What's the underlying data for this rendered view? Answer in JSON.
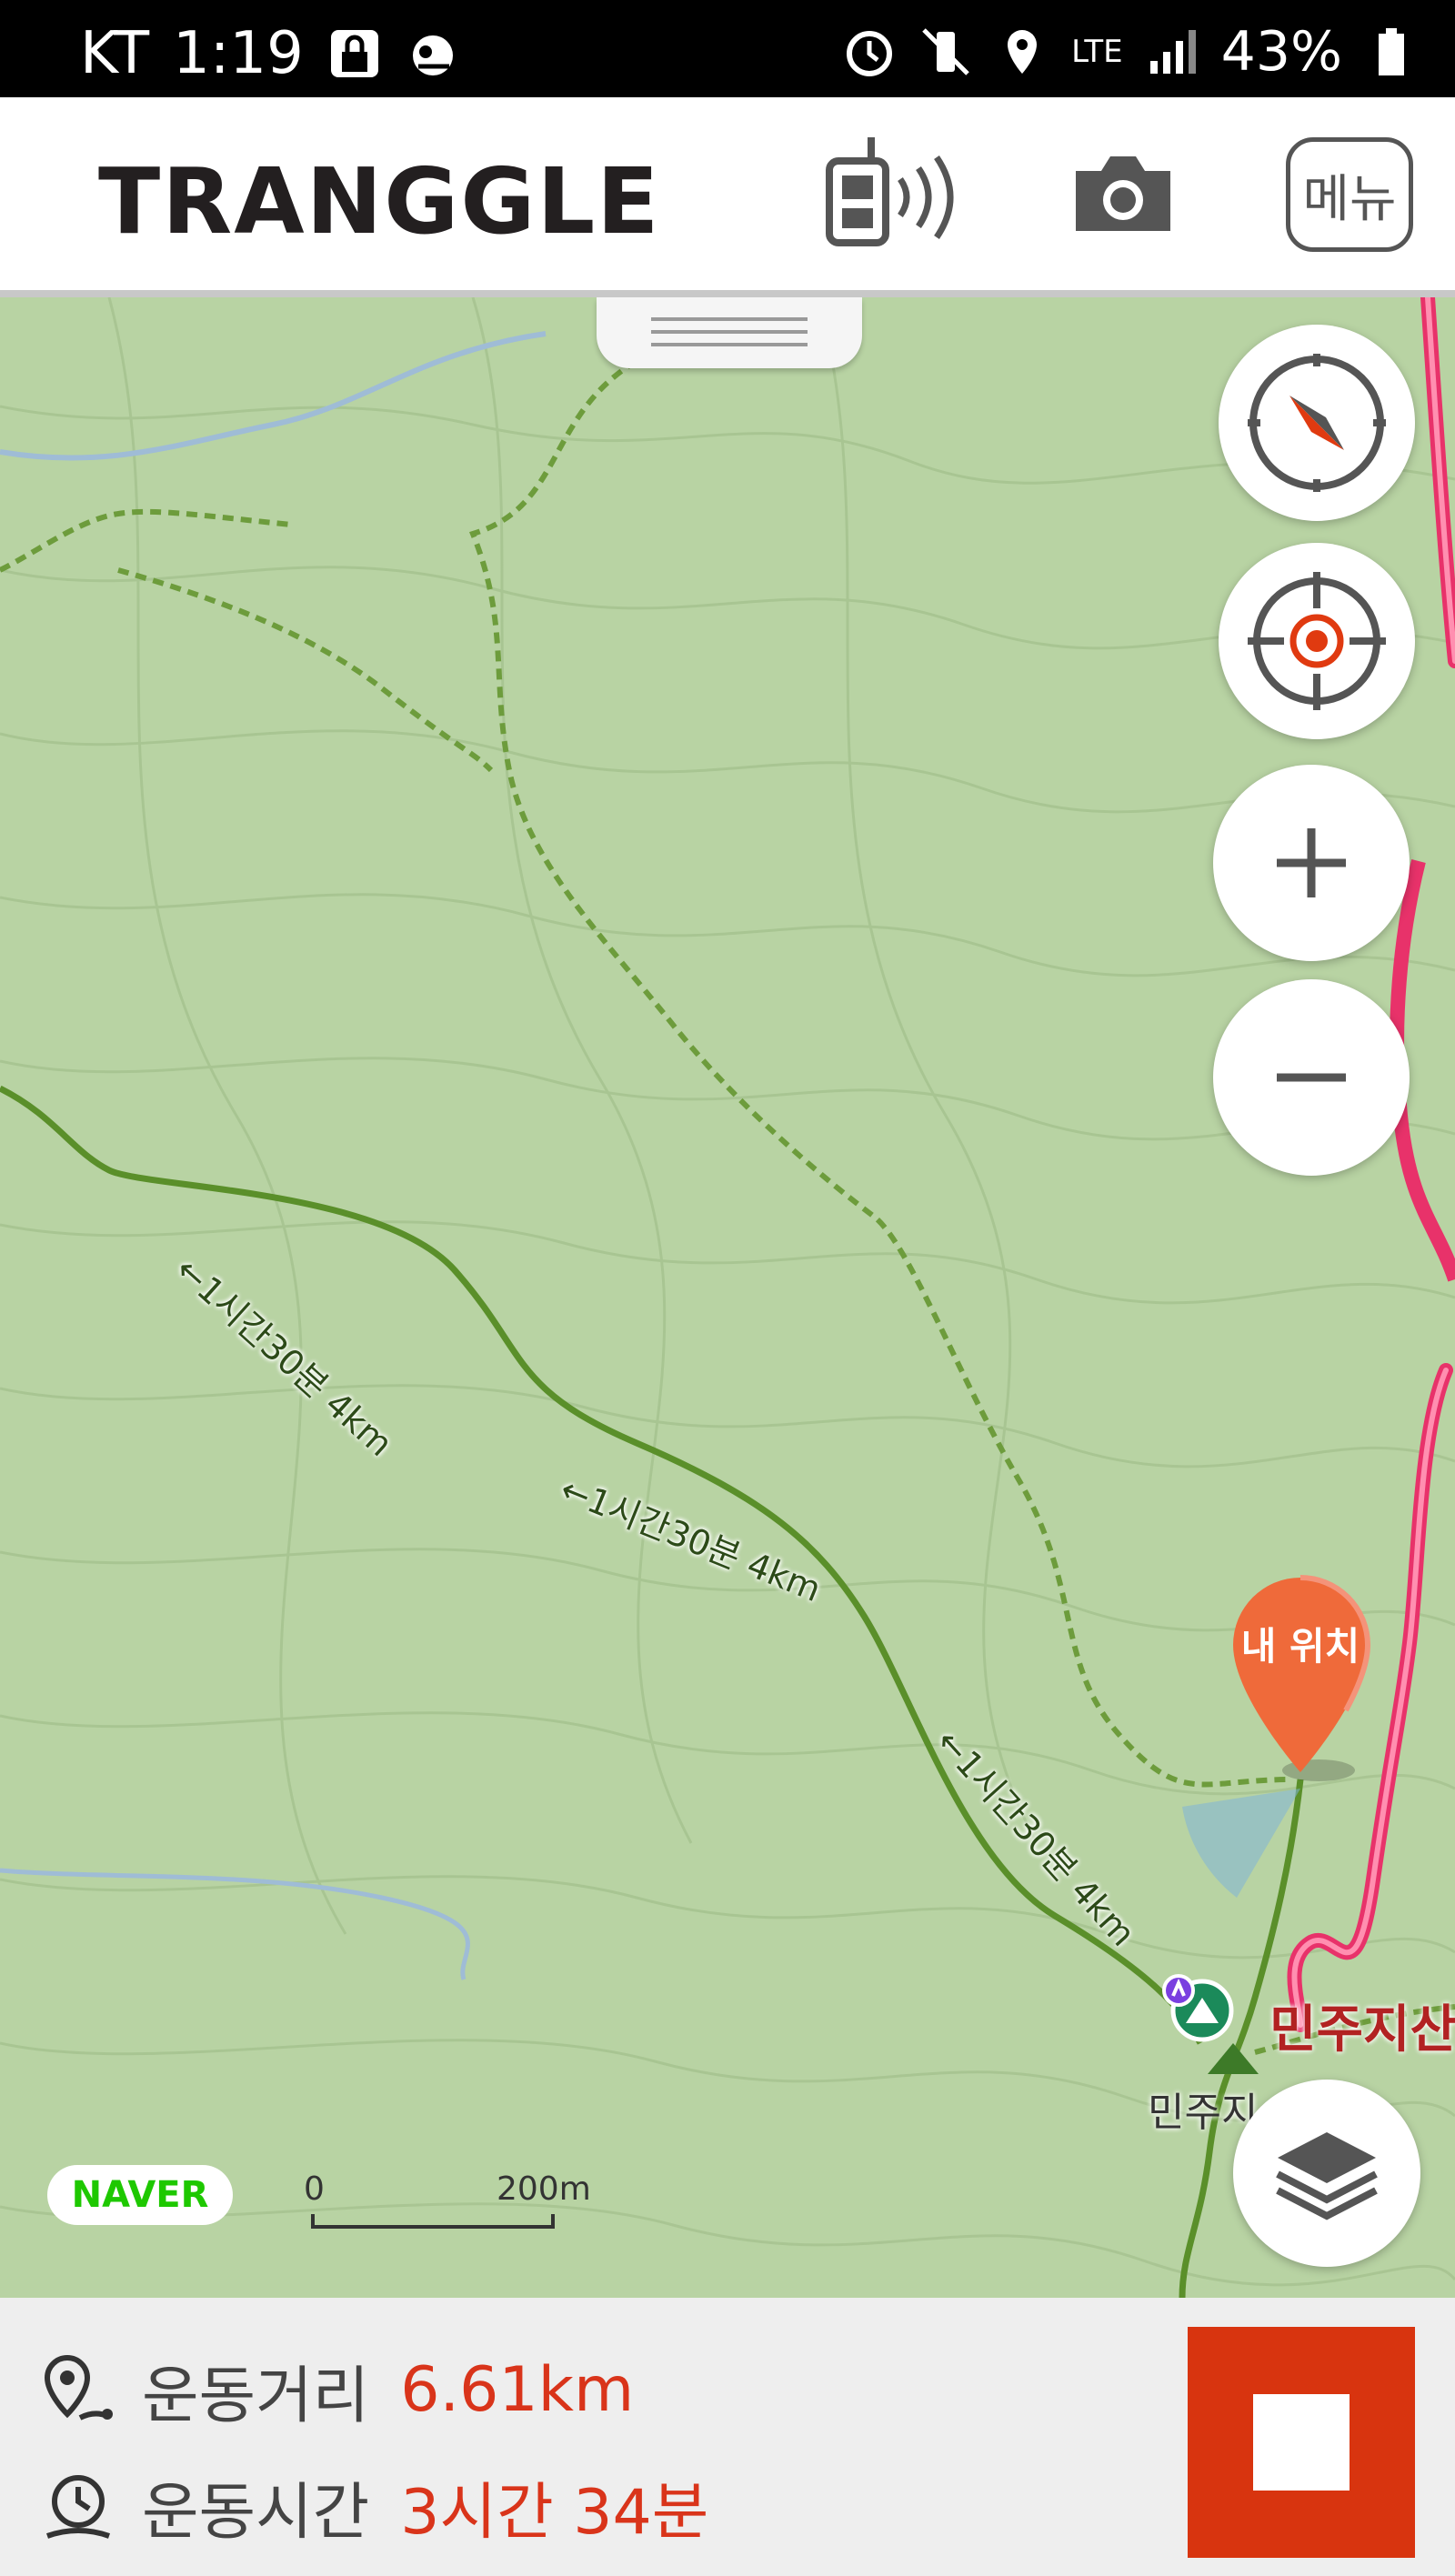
{
  "status_bar": {
    "carrier": "KT",
    "time": "1:19",
    "battery": "43%",
    "network": "LTE"
  },
  "header": {
    "logo": "TRANGGLE",
    "menu_label": "메뉴"
  },
  "map": {
    "trail_labels": [
      "←1시간30분 4km",
      "←1시간30분 4km",
      "←1시간30분 4km"
    ],
    "my_location": "내 위치",
    "place_name": "민주지산",
    "place_name_secondary": "민주지",
    "provider": "NAVER",
    "scale_zero": "0",
    "scale_max": "200m"
  },
  "stats": {
    "distance_label": "운동거리",
    "distance_value": "6.61km",
    "time_label": "운동시간",
    "time_value": "3시간 34분"
  },
  "colors": {
    "accent": "#d9341a",
    "route": "#e8326a",
    "trail": "#5a8f2a"
  }
}
